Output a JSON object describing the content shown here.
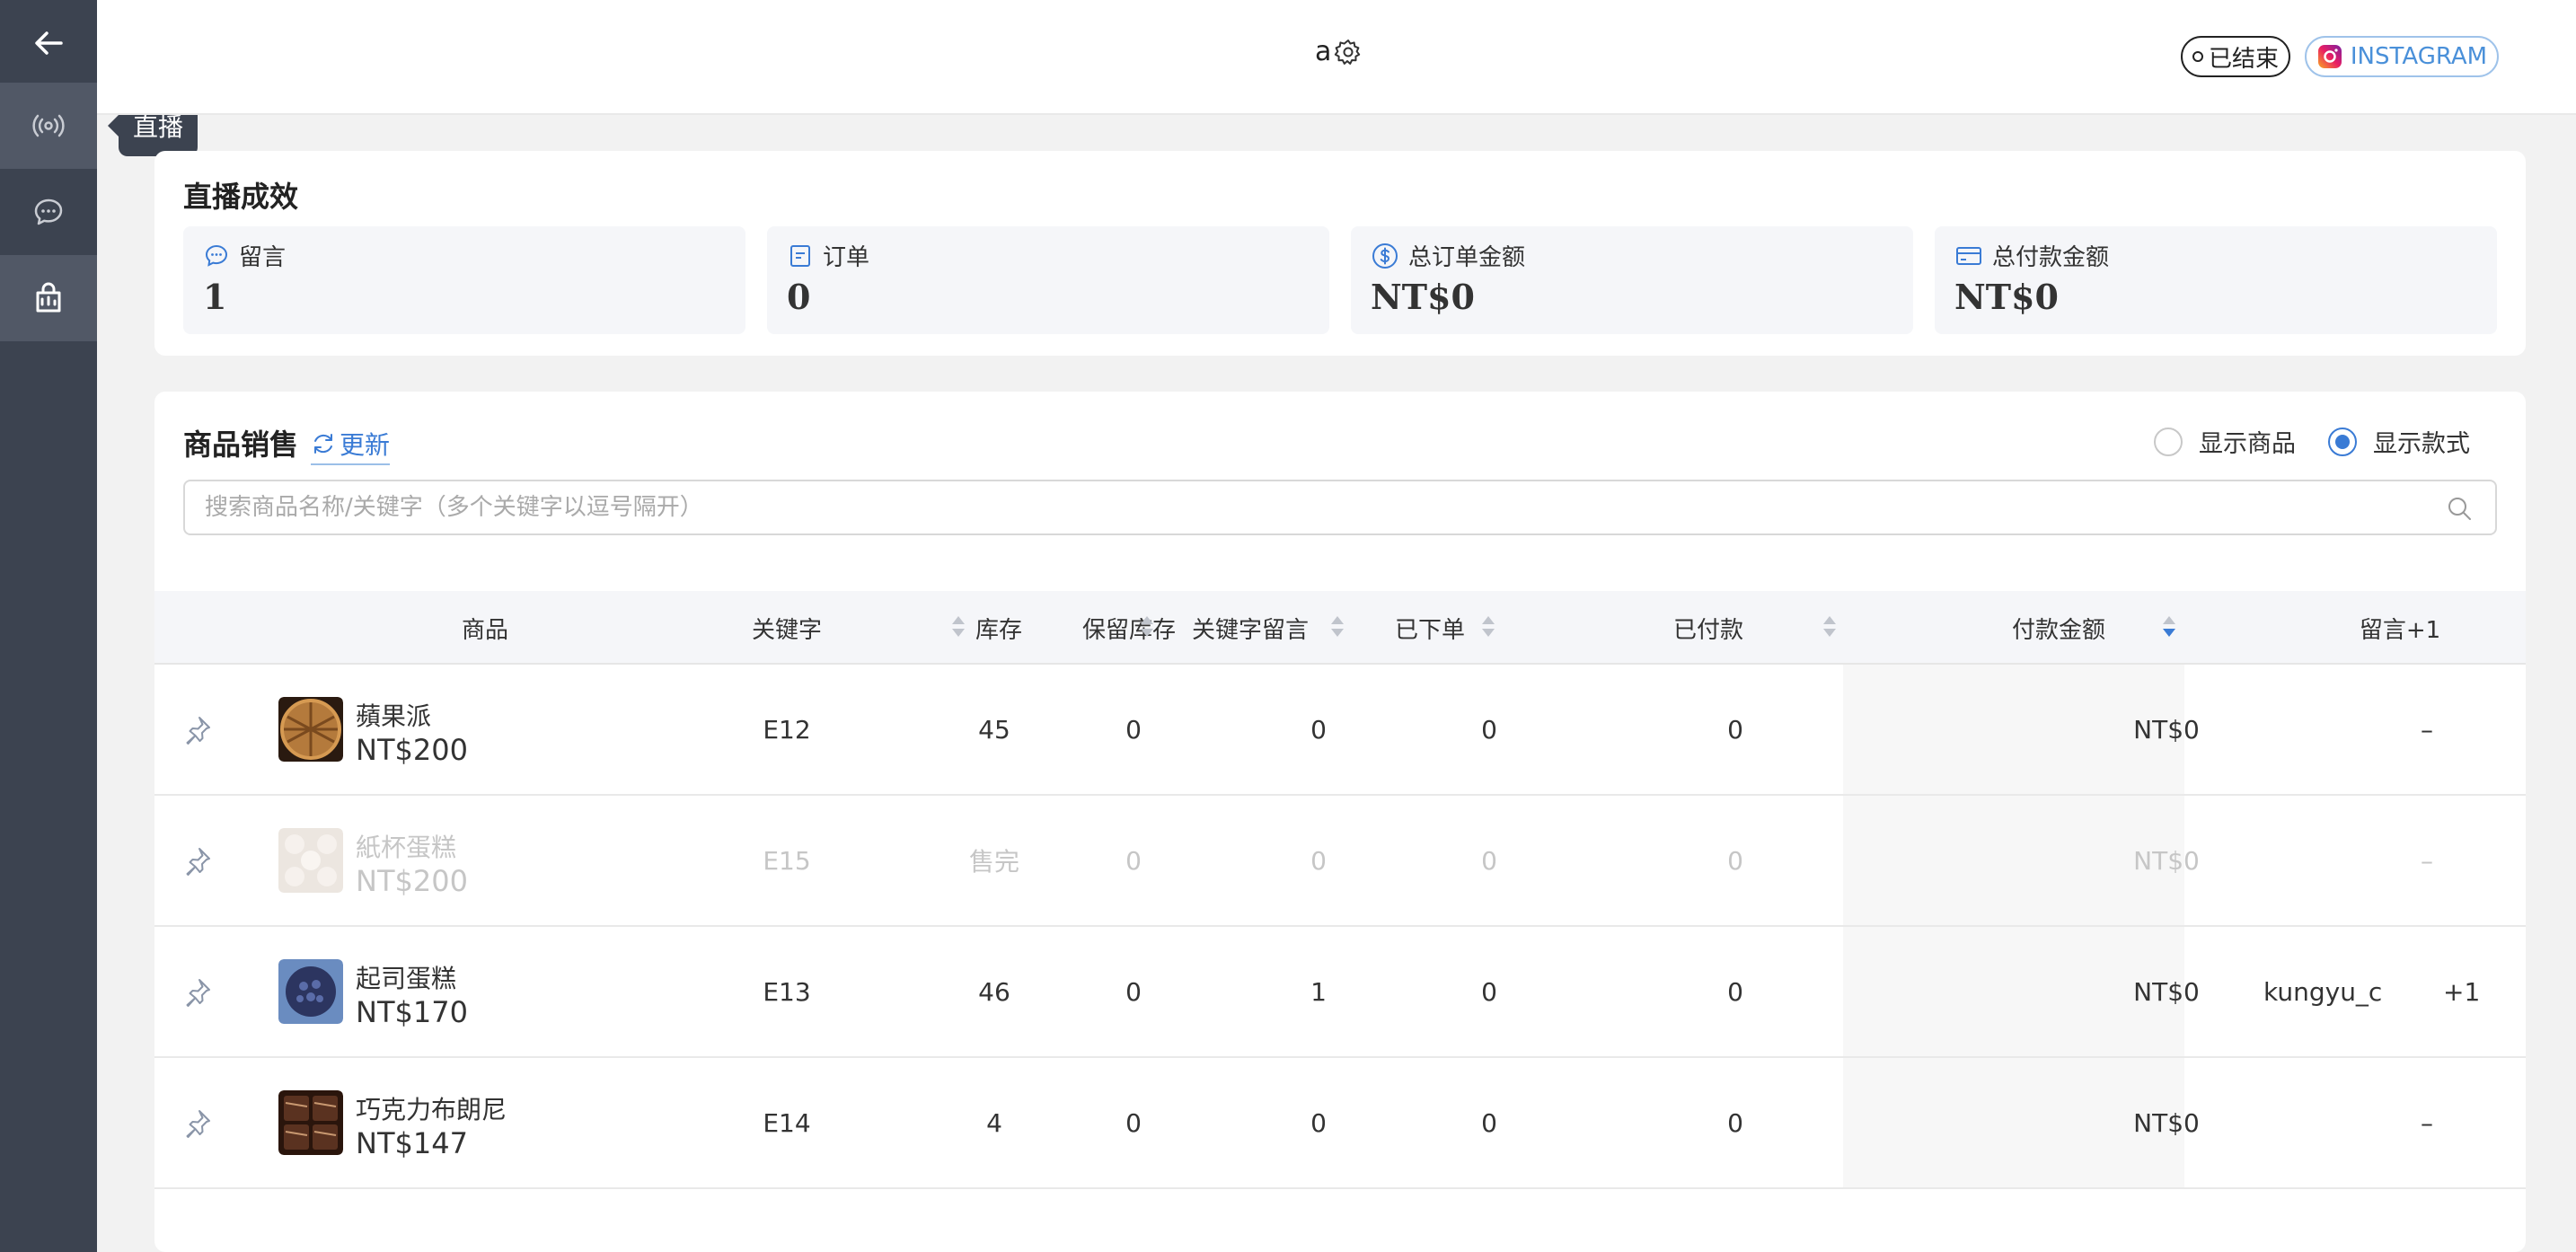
{
  "sidebar": {
    "tooltip": "直播",
    "items": [
      {
        "icon": "back-arrow-icon"
      },
      {
        "icon": "broadcast-icon"
      },
      {
        "icon": "chat-bubble-icon"
      },
      {
        "icon": "shopping-bag-icon"
      }
    ]
  },
  "header": {
    "title": "a",
    "status": "已结束",
    "platform": "INSTAGRAM"
  },
  "performance": {
    "title": "直播成效",
    "stats": [
      {
        "label": "留言",
        "value": "1",
        "icon": "comment-icon"
      },
      {
        "label": "订单",
        "value": "0",
        "icon": "order-icon"
      },
      {
        "label": "总订单金额",
        "value": "NT$0",
        "icon": "dollar-icon"
      },
      {
        "label": "总付款金额",
        "value": "NT$0",
        "icon": "card-icon"
      }
    ]
  },
  "sales": {
    "title": "商品销售",
    "refresh": "更新",
    "radio_products": "显示商品",
    "radio_styles": "显示款式",
    "selected_view": "显示款式",
    "search_placeholder": "搜索商品名称/关键字（多个关键字以逗号隔开）",
    "columns": {
      "product": "商品",
      "keyword": "关键字",
      "stock": "库存",
      "reserved": "保留库存",
      "keyword_comments": "关键字留言",
      "ordered": "已下单",
      "paid": "已付款",
      "pay_amount": "付款金额",
      "comments": "留言+1"
    },
    "rows": [
      {
        "name": "蘋果派",
        "price": "NT$200",
        "keyword": "E12",
        "stock": "45",
        "reserved": "0",
        "keyword_comments": "0",
        "ordered": "0",
        "paid": "0",
        "pay_amount": "NT$0",
        "comment_user": "",
        "comment_plus": "",
        "comment_empty": "–",
        "thumb_color": "#8a5a2b"
      },
      {
        "name": "紙杯蛋糕",
        "price": "NT$200",
        "keyword": "E15",
        "stock": "售完",
        "reserved": "0",
        "keyword_comments": "0",
        "ordered": "0",
        "paid": "0",
        "pay_amount": "NT$0",
        "comment_user": "",
        "comment_plus": "",
        "comment_empty": "–",
        "thumb_color": "#b9aaa0"
      },
      {
        "name": "起司蛋糕",
        "price": "NT$170",
        "keyword": "E13",
        "stock": "46",
        "reserved": "0",
        "keyword_comments": "1",
        "ordered": "0",
        "paid": "0",
        "pay_amount": "NT$0",
        "comment_user": "kungyu_c",
        "comment_plus": "+1",
        "comment_empty": "",
        "thumb_color": "#3b4a7a"
      },
      {
        "name": "巧克力布朗尼",
        "price": "NT$147",
        "keyword": "E14",
        "stock": "4",
        "reserved": "0",
        "keyword_comments": "0",
        "ordered": "0",
        "paid": "0",
        "pay_amount": "NT$0",
        "comment_user": "",
        "comment_plus": "",
        "comment_empty": "–",
        "thumb_color": "#4a2a1c"
      }
    ]
  }
}
